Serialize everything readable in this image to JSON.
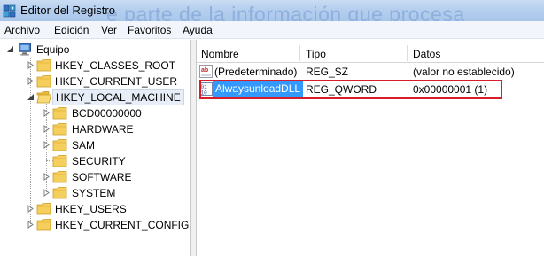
{
  "window": {
    "title": "Editor del Registro",
    "background_text": "e parte de la información que procesa",
    "icon": "registry-editor-icon"
  },
  "menu": [
    {
      "label": "Archivo",
      "underline": "A",
      "rest": "rchivo"
    },
    {
      "label": "Edición",
      "underline": "E",
      "rest": "dición"
    },
    {
      "label": "Ver",
      "underline": "V",
      "rest": "er"
    },
    {
      "label": "Favoritos",
      "underline": "F",
      "rest": "avoritos"
    },
    {
      "label": "Ayuda",
      "underline": "A",
      "rest": "yuda"
    }
  ],
  "tree": {
    "root": "Equipo",
    "hives": [
      "HKEY_CLASSES_ROOT",
      "HKEY_CURRENT_USER",
      "HKEY_LOCAL_MACHINE"
    ],
    "local_machine_children": [
      "BCD00000000",
      "HARDWARE",
      "SAM",
      "SECURITY",
      "SOFTWARE",
      "SYSTEM"
    ],
    "more_hives": [
      "HKEY_USERS",
      "HKEY_CURRENT_CONFIG"
    ],
    "selected": "HKEY_LOCAL_MACHINE"
  },
  "list": {
    "columns": [
      "Nombre",
      "Tipo",
      "Datos"
    ],
    "rows": [
      {
        "name": "(Predeterminado)",
        "type": "REG_SZ",
        "data": "(valor no establecido)",
        "icon": "string-value-icon"
      },
      {
        "name": "AlwaysunloadDLL",
        "type": "REG_QWORD",
        "data": "0x00000001 (1)",
        "icon": "binary-value-icon",
        "selected": true
      }
    ],
    "highlight_color": "#d51e2a",
    "selection_color": "#3399ff"
  }
}
